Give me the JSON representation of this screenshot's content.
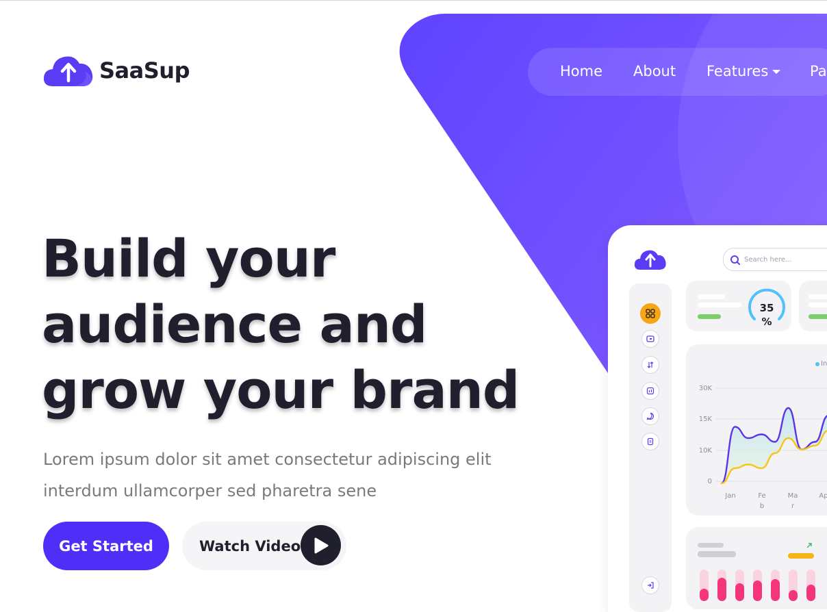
{
  "brand": {
    "name": "SaaSup",
    "logo_icon": "cloud-upload-icon",
    "accent": "#4f2ff7"
  },
  "nav": {
    "items": [
      {
        "label": "Home"
      },
      {
        "label": "About"
      },
      {
        "label": "Features",
        "has_dropdown": true
      },
      {
        "label": "Pa"
      }
    ]
  },
  "hero": {
    "headline_lines": [
      "Build your",
      "audience and",
      "grow your brand"
    ],
    "lead_lines": [
      "Lorem ipsum dolor sit amet consectetur adipiscing elit",
      "interdum ullamcorper sed pharetra sene"
    ],
    "primary_button": "Get Started",
    "video_button": "Watch Video",
    "colors": {
      "purple": "#6d4dff",
      "dark": "#1f1f2e"
    }
  },
  "dashboard": {
    "search_placeholder": "Search here...",
    "gauge": {
      "value_line1": "35",
      "value_line2": "%",
      "percent": 35
    },
    "sidebar_icons": [
      "grid-icon",
      "wallet-icon",
      "transfer-icon",
      "report-icon",
      "chat-icon",
      "document-icon",
      "logout-icon"
    ],
    "legend": "In",
    "chart_data": {
      "type": "line",
      "y_ticks": [
        "30K",
        "15K",
        "10K",
        "0"
      ],
      "x_ticks": [
        {
          "line1": "Jan",
          "line2": ""
        },
        {
          "line1": "Fe",
          "line2": "b"
        },
        {
          "line1": "Ma",
          "line2": "r"
        },
        {
          "line1": "Ap",
          "line2": ""
        }
      ],
      "series": [
        {
          "color": "#5b34e6",
          "values": [
            0,
            15,
            12,
            13,
            11,
            20,
            9,
            11,
            18,
            10
          ]
        },
        {
          "color": "#f5c518",
          "values": [
            0,
            4,
            5,
            4,
            8,
            12,
            9,
            10,
            14,
            16
          ]
        }
      ]
    },
    "mini_bars": {
      "dark_color": "#f4357a",
      "light_color": "#fbd3e0",
      "up_arrow_icon": "trend-up-icon"
    }
  }
}
